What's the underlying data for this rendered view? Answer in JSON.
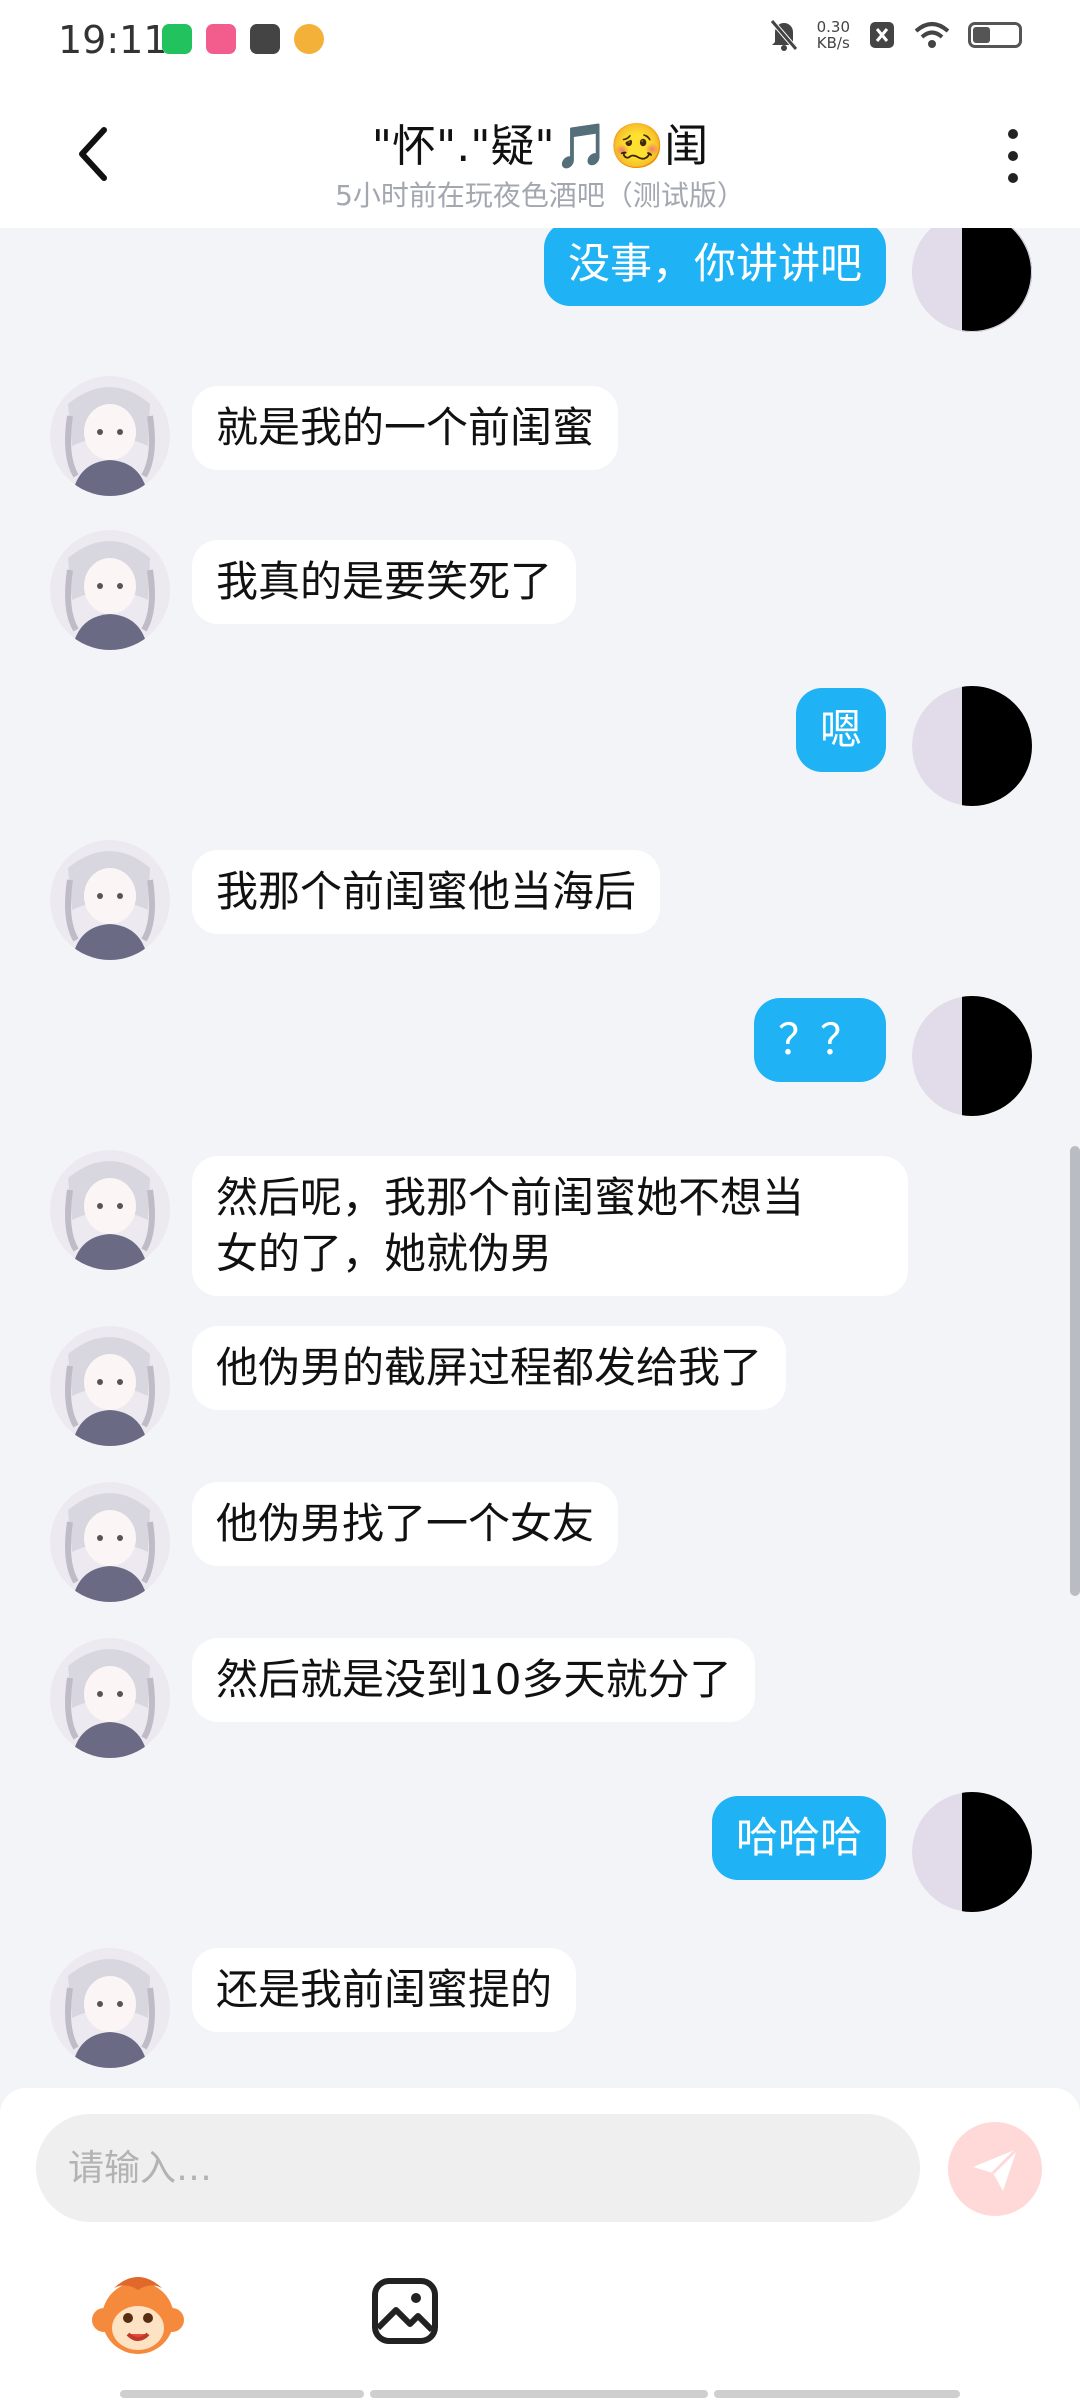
{
  "status_bar": {
    "time": "19:11",
    "net_speed_value": "0.30",
    "net_speed_unit": "KB/s",
    "app_icons": [
      "iqiyi-icon",
      "bilibili-icon",
      "mail-icon",
      "game-icon"
    ],
    "battery_level": 0.35
  },
  "header": {
    "title": "\"怀\".\"疑\"🎵🥴闺",
    "subtitle": "5小时前在玩夜色酒吧（测试版）"
  },
  "messages": [
    {
      "side": "out",
      "text": "没事，你讲讲吧"
    },
    {
      "side": "in",
      "text": "就是我的一个前闺蜜"
    },
    {
      "side": "in",
      "text": "我真的是要笑死了"
    },
    {
      "side": "out",
      "text": "嗯"
    },
    {
      "side": "in",
      "text": "我那个前闺蜜他当海后"
    },
    {
      "side": "out",
      "text": "？？"
    },
    {
      "side": "in",
      "text": "然后呢，我那个前闺蜜她不想当\n女的了，她就伪男"
    },
    {
      "side": "in",
      "text": "他伪男的截屏过程都发给我了"
    },
    {
      "side": "in",
      "text": "他伪男找了一个女友"
    },
    {
      "side": "in",
      "text": "然后就是没到10多天就分了"
    },
    {
      "side": "out",
      "text": "哈哈哈"
    },
    {
      "side": "in",
      "text": "还是我前闺蜜提的"
    }
  ],
  "composer": {
    "placeholder": "请输入…"
  },
  "colors": {
    "outgoing_bubble": "#1fb2f4",
    "incoming_bubble": "#ffffff",
    "background": "#f3f4f8",
    "send_button": "#ffd8d8"
  }
}
